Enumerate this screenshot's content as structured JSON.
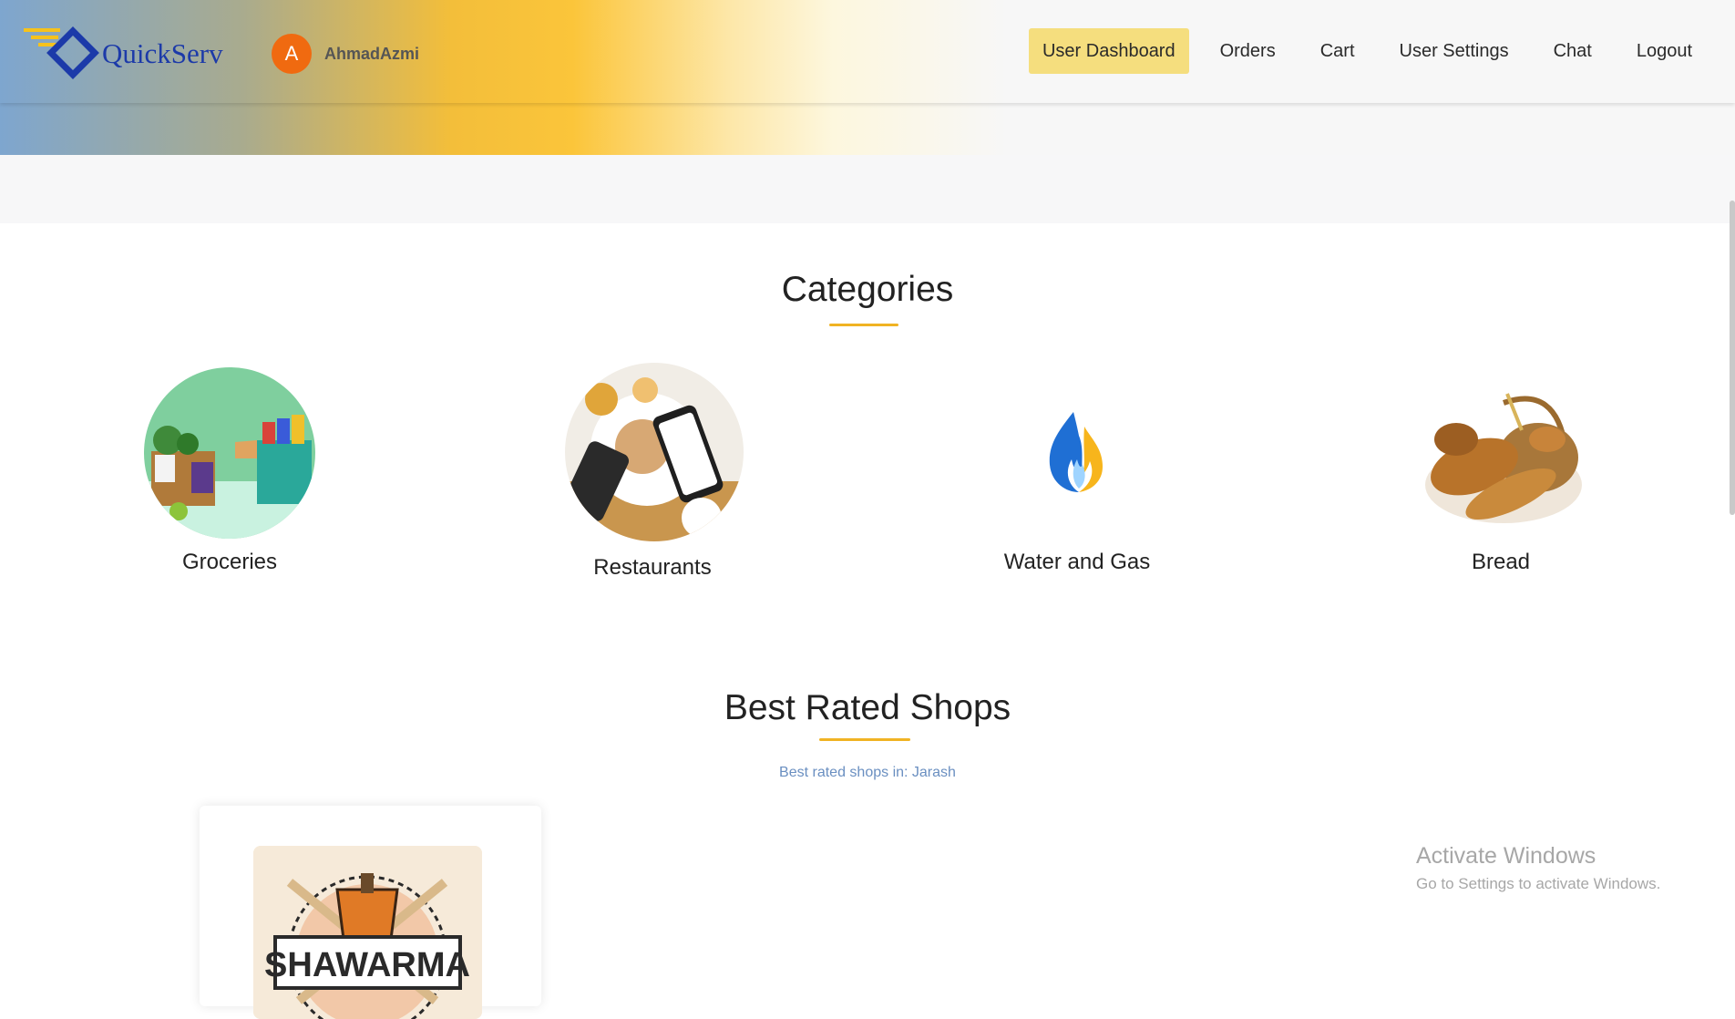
{
  "brand": {
    "name": "QuickServ"
  },
  "user": {
    "initial": "A",
    "name": "AhmadAzmi"
  },
  "nav": {
    "items": [
      {
        "label": "User Dashboard",
        "active": true
      },
      {
        "label": "Orders"
      },
      {
        "label": "Cart"
      },
      {
        "label": "User Settings"
      },
      {
        "label": "Chat"
      },
      {
        "label": "Logout"
      }
    ]
  },
  "categories": {
    "title": "Categories",
    "items": [
      {
        "label": "Groceries",
        "icon": "groceries-image"
      },
      {
        "label": "Restaurants",
        "icon": "restaurants-image"
      },
      {
        "label": "Water and Gas",
        "icon": "flame-icon"
      },
      {
        "label": "Bread",
        "icon": "bread-basket-image"
      }
    ]
  },
  "best_rated": {
    "title": "Best Rated Shops",
    "subtitle": "Best rated shops in: Jarash",
    "shops": [
      {
        "logo_text": "SHAWARMA"
      }
    ]
  },
  "watermark": {
    "title": "Activate Windows",
    "subtitle": "Go to Settings to activate Windows."
  },
  "colors": {
    "accent": "#f0b323",
    "active_nav": "#f5de7e",
    "brand_blue": "#1c3aa9",
    "avatar": "#f06a10"
  }
}
